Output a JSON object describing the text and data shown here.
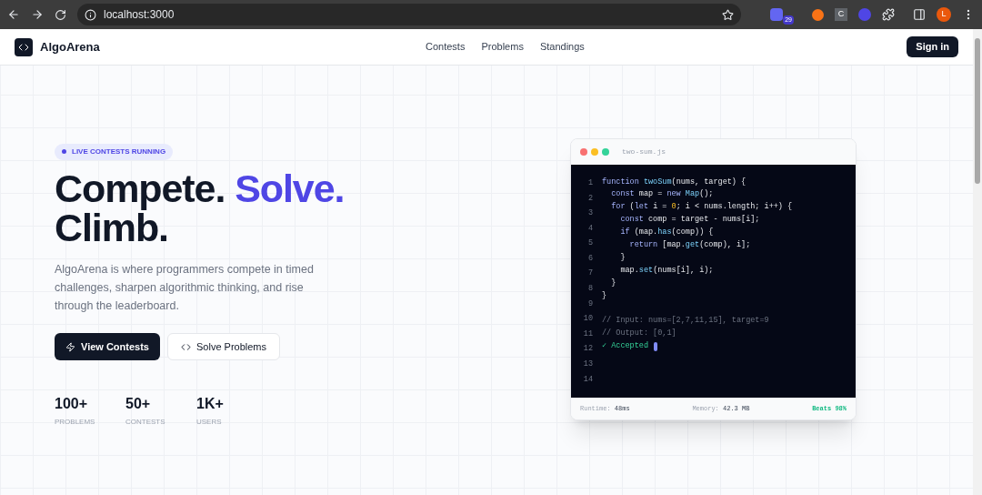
{
  "browser": {
    "url": "localhost:3000",
    "extension_badge": "29",
    "extension_letter": "C",
    "profile_initial": "L"
  },
  "nav": {
    "brand": "AlgoArena",
    "links": [
      "Contests",
      "Problems",
      "Standings"
    ],
    "sign_in": "Sign in"
  },
  "hero": {
    "badge": "LIVE CONTESTS RUNNING",
    "heading": [
      [
        {
          "text": "Compete.",
          "kind": "plain"
        },
        {
          "text": "Solve.",
          "kind": "accent"
        }
      ],
      [
        {
          "text": "Climb.",
          "kind": "plain"
        }
      ]
    ],
    "description": "AlgoArena is where programmers compete in timed challenges, sharpen algorithmic thinking, and rise through the leaderboard.",
    "buttons": [
      {
        "label": "View Contests",
        "kind": "primary"
      },
      {
        "label": "Solve Problems",
        "kind": "secondary"
      }
    ],
    "stats": [
      {
        "value": "100+",
        "label": "PROBLEMS"
      },
      {
        "value": "50+",
        "label": "CONTESTS"
      },
      {
        "value": "1K+",
        "label": "USERS"
      }
    ]
  },
  "editor": {
    "filename": "two-sum.js",
    "line_numbers": [
      "1",
      "2",
      "3",
      "4",
      "5",
      "6",
      "7",
      "8",
      "9",
      "10",
      "11",
      "12",
      "13",
      "14"
    ],
    "lines": [
      {
        "kind": "code",
        "tokens": [
          {
            "text": "function ",
            "kind": "keyword"
          },
          {
            "text": "twoSum",
            "kind": "function"
          },
          {
            "text": "(nums, target) {",
            "kind": "plain"
          }
        ]
      },
      {
        "kind": "code",
        "tokens": [
          {
            "text": "  const ",
            "kind": "keyword"
          },
          {
            "text": "map = ",
            "kind": "plain"
          },
          {
            "text": "new ",
            "kind": "keyword"
          },
          {
            "text": "Map",
            "kind": "function"
          },
          {
            "text": "();",
            "kind": "plain"
          }
        ]
      },
      {
        "kind": "code",
        "tokens": [
          {
            "text": "  for ",
            "kind": "keyword"
          },
          {
            "text": "(",
            "kind": "plain"
          },
          {
            "text": "let ",
            "kind": "keyword"
          },
          {
            "text": "i = ",
            "kind": "plain"
          },
          {
            "text": "0",
            "kind": "number"
          },
          {
            "text": "; i < nums.length; i++) {",
            "kind": "plain"
          }
        ]
      },
      {
        "kind": "code",
        "tokens": [
          {
            "text": "    const ",
            "kind": "keyword"
          },
          {
            "text": "comp = target - nums[i];",
            "kind": "plain"
          }
        ]
      },
      {
        "kind": "code",
        "tokens": [
          {
            "text": "    if ",
            "kind": "keyword"
          },
          {
            "text": "(map.",
            "kind": "plain"
          },
          {
            "text": "has",
            "kind": "function"
          },
          {
            "text": "(comp)) {",
            "kind": "plain"
          }
        ]
      },
      {
        "kind": "code",
        "tokens": [
          {
            "text": "      return ",
            "kind": "keyword"
          },
          {
            "text": "[map.",
            "kind": "plain"
          },
          {
            "text": "get",
            "kind": "function"
          },
          {
            "text": "(comp), i];",
            "kind": "plain"
          }
        ]
      },
      {
        "kind": "code",
        "tokens": [
          {
            "text": "    }",
            "kind": "plain"
          }
        ]
      },
      {
        "kind": "code",
        "tokens": [
          {
            "text": "    map.",
            "kind": "plain"
          },
          {
            "text": "set",
            "kind": "function"
          },
          {
            "text": "(nums[i], i);",
            "kind": "plain"
          }
        ]
      },
      {
        "kind": "code",
        "tokens": [
          {
            "text": "  }",
            "kind": "plain"
          }
        ]
      },
      {
        "kind": "code",
        "tokens": [
          {
            "text": "}",
            "kind": "plain"
          }
        ]
      },
      {
        "kind": "blank"
      },
      {
        "kind": "code",
        "tokens": [
          {
            "text": "// Input: nums=[2,7,11,15], target=9",
            "kind": "comment"
          }
        ]
      },
      {
        "kind": "code",
        "tokens": [
          {
            "text": "// Output: [0,1]",
            "kind": "comment"
          }
        ]
      },
      {
        "kind": "code",
        "cursor": true,
        "tokens": [
          {
            "text": "✓ Accepted",
            "kind": "success"
          }
        ]
      }
    ],
    "footer": [
      {
        "label": "Runtime:",
        "value": "48ms",
        "kind": "metric"
      },
      {
        "label": "Memory:",
        "value": "42.3 MB",
        "kind": "metric"
      },
      {
        "value": "Beats 98%",
        "kind": "success"
      }
    ]
  }
}
